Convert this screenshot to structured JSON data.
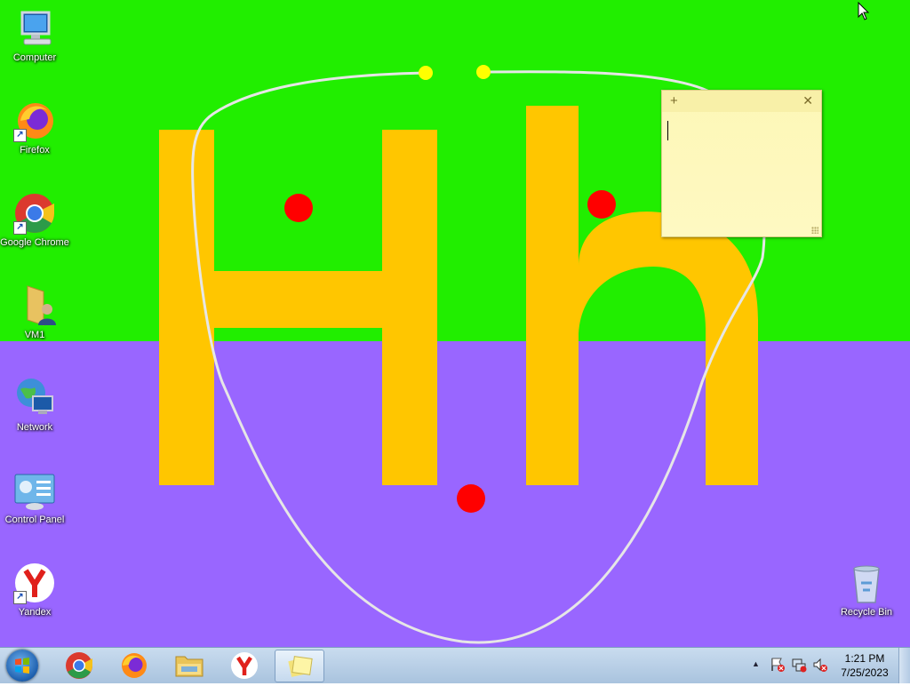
{
  "desktop": {
    "icons": [
      {
        "label": "Computer",
        "icon": "computer-icon"
      },
      {
        "label": "Firefox",
        "icon": "firefox-icon"
      },
      {
        "label": "Google Chrome",
        "icon": "chrome-icon"
      },
      {
        "label": "VM1",
        "icon": "user-folder-icon"
      },
      {
        "label": "Network",
        "icon": "network-icon"
      },
      {
        "label": "Control Panel",
        "icon": "control-panel-icon"
      },
      {
        "label": "Yandex",
        "icon": "yandex-icon"
      },
      {
        "label": "Recycle Bin",
        "icon": "recycle-bin-icon"
      }
    ],
    "wallpaper": {
      "letters": "Hh",
      "colors": {
        "top": "#21ee00",
        "bottom": "#9966ff",
        "letters": "#ffc600",
        "dots": "#ff0000",
        "curve": "#e6e6e6",
        "handles": "#ffff00"
      }
    }
  },
  "sticky_note": {
    "add_label": "+",
    "close_label": "✕",
    "text": ""
  },
  "taskbar": {
    "pinned": [
      {
        "name": "Google Chrome",
        "icon": "chrome-icon"
      },
      {
        "name": "Firefox",
        "icon": "firefox-icon"
      },
      {
        "name": "Windows Explorer",
        "icon": "folder-icon"
      },
      {
        "name": "Yandex",
        "icon": "yandex-icon"
      },
      {
        "name": "Sticky Notes",
        "icon": "sticky-notes-icon",
        "active": true
      }
    ],
    "tray": {
      "show_hidden": "▲"
    },
    "clock": {
      "time": "1:21 PM",
      "date": "7/25/2023"
    }
  }
}
